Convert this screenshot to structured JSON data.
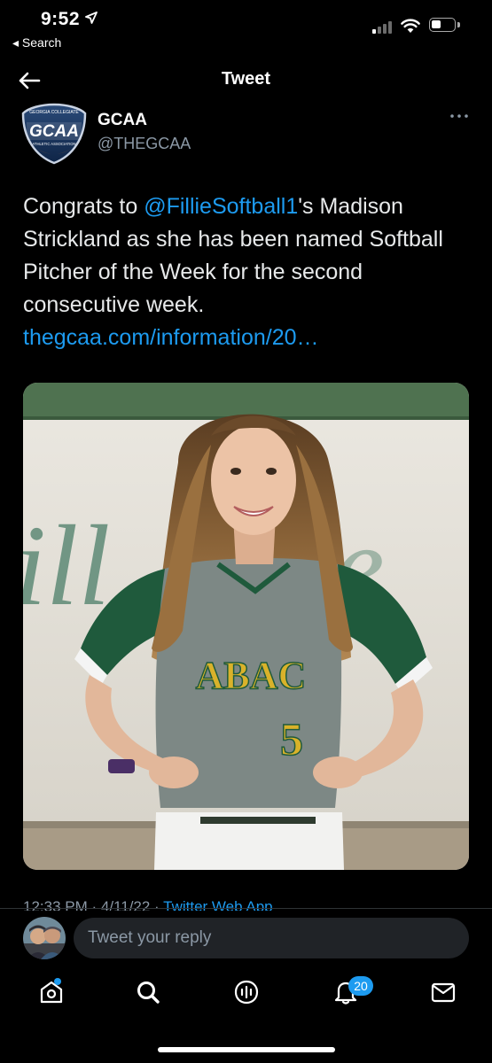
{
  "status_bar": {
    "time": "9:52",
    "back_app": "◂ Search"
  },
  "header": {
    "title": "Tweet"
  },
  "tweet": {
    "author_name": "GCAA",
    "author_handle": "@THEGCAA",
    "logo_top_text": "GEORGIA COLLEGIATE",
    "logo_main_text": "GCAA",
    "logo_bottom_text": "ATHLETIC ASSOCIATION",
    "text_before_mention": "Congrats to ",
    "mention": "@FillieSoftball1",
    "text_after_mention": "'s Madison Strickland as she has been named Softball Pitcher of the Week for the second consecutive week.",
    "link": "thegcaa.com/information/20…",
    "jersey_text": "ABAC",
    "jersey_number": "5",
    "meta_time": "12:33 PM · 4/11/22 · ",
    "meta_app": "Twitter Web App"
  },
  "reply": {
    "placeholder": "Tweet your reply"
  },
  "bottom_nav": {
    "notifications_badge": "20"
  },
  "colors": {
    "accent": "#1d9bf0",
    "background": "#000000",
    "secondary_text": "#8b98a5"
  }
}
